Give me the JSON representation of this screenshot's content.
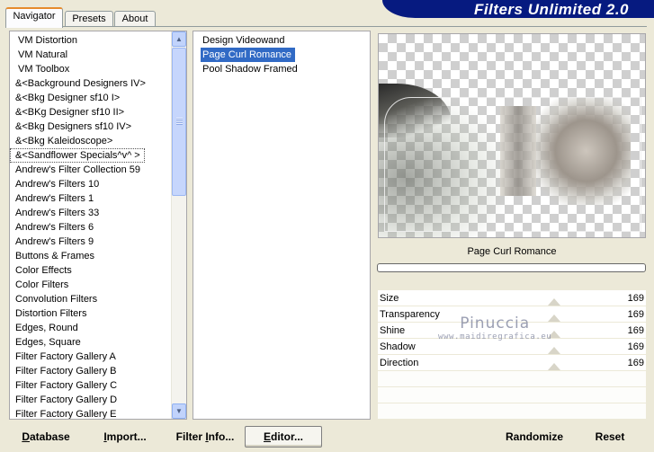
{
  "header": {
    "title": "Filters Unlimited 2.0",
    "tabs": [
      {
        "label": "Navigator",
        "active": true
      },
      {
        "label": "Presets",
        "active": false
      },
      {
        "label": "About",
        "active": false
      }
    ]
  },
  "categories": {
    "items": [
      {
        "label": "VM Distortion"
      },
      {
        "label": "VM Natural"
      },
      {
        "label": "VM Toolbox"
      },
      {
        "label": "&<Background Designers IV>"
      },
      {
        "label": "&<Bkg Designer sf10 I>"
      },
      {
        "label": "&<BKg Designer sf10 II>"
      },
      {
        "label": "&<Bkg Designers sf10 IV>"
      },
      {
        "label": "&<Bkg Kaleidoscope>"
      },
      {
        "label": "&<Sandflower Specials^v^ >",
        "current": true
      },
      {
        "label": "Andrew's Filter Collection 59"
      },
      {
        "label": "Andrew's Filters 10"
      },
      {
        "label": "Andrew's Filters 1"
      },
      {
        "label": "Andrew's Filters 33"
      },
      {
        "label": "Andrew's Filters 6"
      },
      {
        "label": "Andrew's Filters 9"
      },
      {
        "label": "Buttons & Frames"
      },
      {
        "label": "Color Effects"
      },
      {
        "label": "Color Filters"
      },
      {
        "label": "Convolution Filters"
      },
      {
        "label": "Distortion Filters"
      },
      {
        "label": "Edges, Round"
      },
      {
        "label": "Edges, Square"
      },
      {
        "label": "Filter Factory Gallery A"
      },
      {
        "label": "Filter Factory Gallery B"
      },
      {
        "label": "Filter Factory Gallery C"
      },
      {
        "label": "Filter Factory Gallery D"
      },
      {
        "label": "Filter Factory Gallery E"
      }
    ],
    "scroll_up_icon": "triangle-up-icon",
    "scroll_down_icon": "triangle-down-icon"
  },
  "filters": {
    "items": [
      {
        "label": "Design Videowand"
      },
      {
        "label": "Page Curl Romance",
        "selected": true
      },
      {
        "label": "Pool Shadow Framed"
      }
    ]
  },
  "preview": {
    "filter_name": "Page Curl Romance"
  },
  "params": [
    {
      "label": "Size",
      "value": "169"
    },
    {
      "label": "Transparency",
      "value": "169"
    },
    {
      "label": "Shine",
      "value": "169"
    },
    {
      "label": "Shadow",
      "value": "169"
    },
    {
      "label": "Direction",
      "value": "169"
    }
  ],
  "watermark": {
    "line1": "Pinuccia",
    "line2": "www.maidiregrafica.eu"
  },
  "footer": {
    "database": {
      "ul": "D",
      "rest": "atabase"
    },
    "import": {
      "ul": "I",
      "rest": "mport..."
    },
    "filter_info": {
      "pre": "Filter ",
      "ul": "I",
      "rest": "nfo..."
    },
    "editor": {
      "ul": "E",
      "rest": "ditor..."
    },
    "randomize": "Randomize",
    "reset": "Reset"
  },
  "colors": {
    "banner": "#061a80",
    "selection": "#316ac5",
    "window_bg": "#ece9d8"
  }
}
